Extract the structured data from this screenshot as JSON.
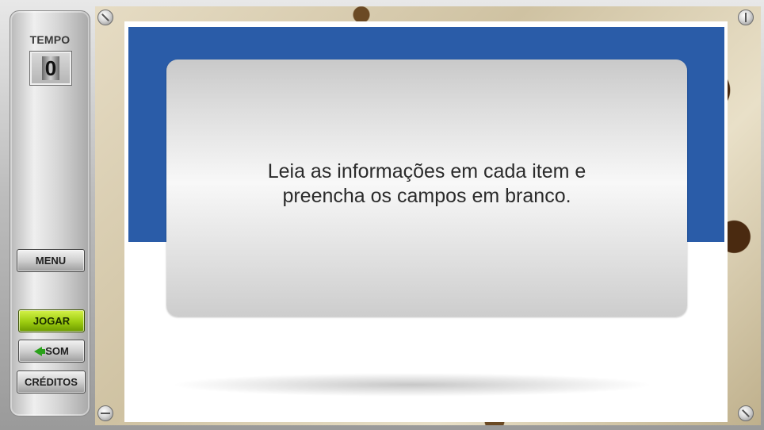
{
  "timer": {
    "label": "TEMPO",
    "value": "0"
  },
  "menu": {
    "label": "MENU"
  },
  "controls": {
    "play_label": "JOGAR",
    "sound_label": "SOM",
    "credits_label": "CRÉDITOS"
  },
  "dialog": {
    "message": "Leia as informações em cada item e\npreencha os campos em branco."
  },
  "colors": {
    "header_blue": "#2a5ca8",
    "play_green": "#9ccc10",
    "sound_icon_green": "#2aa11a"
  },
  "icons": {
    "sound": "speaker-icon",
    "screws": "screw-icon"
  }
}
